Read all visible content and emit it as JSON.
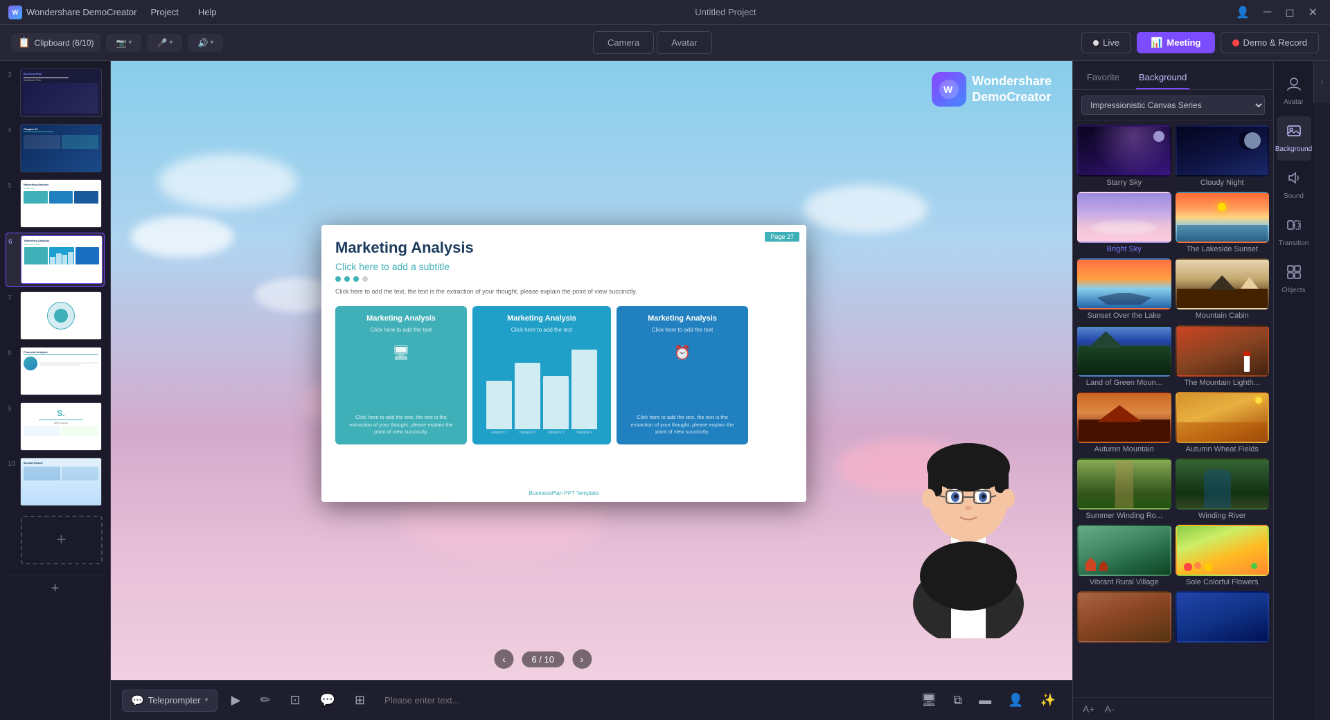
{
  "app": {
    "name": "Wondershare DemoCreator",
    "title": "Untitled Project"
  },
  "menu": {
    "items": [
      "Project",
      "Help"
    ]
  },
  "toolbar": {
    "clipboard": "Clipboard (6/10)",
    "camera_label": "Camera",
    "avatar_label": "Avatar",
    "live_label": "Live",
    "meeting_label": "Meeting",
    "demo_label": "Demo & Record"
  },
  "slides": [
    {
      "number": 3,
      "type": "dark-blue"
    },
    {
      "number": 4,
      "type": "dark-blue2"
    },
    {
      "number": 5,
      "type": "white-marketing"
    },
    {
      "number": 6,
      "type": "white-main",
      "active": true
    },
    {
      "number": 7,
      "type": "white-diagram"
    },
    {
      "number": 8,
      "type": "white-financial"
    },
    {
      "number": 9,
      "type": "white-s"
    },
    {
      "number": 10,
      "type": "white-annual"
    }
  ],
  "presentation": {
    "title": "Marketing Analysis",
    "subtitle": "Click here to add a subtitle",
    "body": "Click here to add the text, the text is the extraction of your thought, please explain the point of view succinctly.",
    "page_badge": "Page 27",
    "footer": "BusinessPlan PPT Template",
    "card1_title": "Marketing Analysis",
    "card1_sub": "Click here to add the text",
    "card1_text": "Click here to add the text, the text is the extraction of your thought, please explain the point of view succinctly.",
    "card2_title": "Marketing Analysis",
    "card2_sub": "Click here to add the text",
    "bar_labels": [
      "category 1",
      "category 2",
      "category 3",
      "category 4"
    ],
    "card3_title": "Marketing Analysis",
    "card3_sub": "Click here to add the text",
    "card3_text": "Click here to add the text, the text is the extraction of your thought, please explain the point of view succinctly.",
    "nav_current": "6",
    "nav_total": "10"
  },
  "ws_logo": {
    "line1": "Wondershare",
    "line2": "DemoCreator"
  },
  "bottom_bar": {
    "teleprompter_label": "Teleprompter",
    "input_placeholder": "Please enter text..."
  },
  "right_panel": {
    "tabs": [
      "Favorite",
      "Background"
    ],
    "active_tab": "Background",
    "filter": "Impressionistic Canvas Series",
    "backgrounds": [
      {
        "id": "starry-sky",
        "label": "Starry Sky",
        "class": "bg-starry"
      },
      {
        "id": "cloudy-night",
        "label": "Cloudy Night",
        "class": "bg-cloudy-night"
      },
      {
        "id": "bright-sky",
        "label": "Bright Sky",
        "class": "bg-bright-sky",
        "selected": false,
        "highlighted": true
      },
      {
        "id": "lakeside-sunset",
        "label": "The Lakeside Sunset",
        "class": "bg-lakeside"
      },
      {
        "id": "sunset-lake",
        "label": "Sunset Over the Lake",
        "class": "bg-sunset-lake"
      },
      {
        "id": "mountain-cabin",
        "label": "Mountain Cabin",
        "class": "bg-mountain-cabin"
      },
      {
        "id": "green-mountain",
        "label": "Land of Green Moun...",
        "class": "bg-green-mountain"
      },
      {
        "id": "mountain-light",
        "label": "The Mountain Lighth...",
        "class": "bg-mountain-light"
      },
      {
        "id": "autumn-mountain",
        "label": "Autumn Mountain",
        "class": "bg-autumn-mountain"
      },
      {
        "id": "autumn-wheat",
        "label": "Autumn Wheat Fields",
        "class": "bg-autumn-wheat"
      },
      {
        "id": "summer-winding",
        "label": "Summer Winding Ro...",
        "class": "bg-summer-winding"
      },
      {
        "id": "winding-river",
        "label": "Winding River",
        "class": "bg-winding-river"
      },
      {
        "id": "rural-village",
        "label": "Vibrant Rural Village",
        "class": "bg-rural-village"
      },
      {
        "id": "colorful-flowers",
        "label": "Sole Colorful Flowers",
        "class": "bg-colorful-flowers"
      },
      {
        "id": "more1",
        "label": "",
        "class": "bg-more1"
      },
      {
        "id": "more2",
        "label": "",
        "class": "bg-more2"
      }
    ]
  },
  "icon_sidebar": {
    "items": [
      {
        "id": "avatar",
        "label": "Avatar",
        "icon": "👤"
      },
      {
        "id": "background",
        "label": "Background",
        "icon": "🖼️",
        "active": true
      },
      {
        "id": "sound",
        "label": "Sound",
        "icon": "🔊"
      },
      {
        "id": "transition",
        "label": "Transition",
        "icon": "▶"
      },
      {
        "id": "objects",
        "label": "Objects",
        "icon": "⊞"
      }
    ]
  }
}
